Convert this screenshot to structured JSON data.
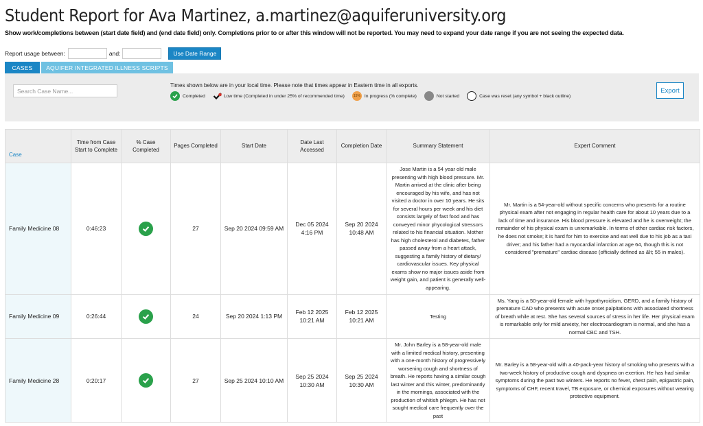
{
  "page": {
    "title": "Student Report for Ava Martinez, a.martinez@aquiferuniversity.org",
    "subtitle": "Show work/completions between (start date field) and (end date field) only. Completions prior to or after this window will not be reported. You may need to expand your date range if you are not seeing the expected data."
  },
  "range": {
    "label_between": "Report usage between:",
    "label_and": "and:",
    "start_value": "",
    "end_value": "",
    "button": "Use Date Range"
  },
  "tabs": [
    {
      "label": "CASES",
      "active": true
    },
    {
      "label": "AQUIFER INTEGRATED ILLNESS SCRIPTS",
      "active": false
    }
  ],
  "panel": {
    "search_placeholder": "Search Case Name...",
    "note": "Times shown below are in your local time. Please note that times appear in Eastern time in all exports.",
    "legend": {
      "completed": "Completed",
      "low_time": "Low time (Completed in under 25% of recommended time)",
      "in_progress_badge": "15%",
      "in_progress": "In progress (% complete)",
      "not_started": "Not started",
      "reset": "Case was reset (any symbol + black outline)"
    },
    "export": "Export"
  },
  "colors": {
    "accent": "#1b86c5",
    "tab_inactive": "#6fc1e2",
    "completed": "#2aa14b",
    "in_progress": "#f0a04a",
    "not_started": "#888888",
    "low_time_mark": "#d0342c"
  },
  "table": {
    "headers": {
      "case": "Case",
      "time": "Time from Case Start to Complete",
      "pct": "% Case Completed",
      "pages": "Pages Completed",
      "start": "Start Date",
      "last": "Date Last Accessed",
      "completion": "Completion Date",
      "summary": "Summary Statement",
      "expert": "Expert Comment"
    },
    "rows": [
      {
        "case": "Family Medicine 08",
        "time": "0:46:23",
        "status": "completed",
        "pages": "27",
        "start": "Sep 20 2024 09:59 AM",
        "last": "Dec 05 2024 4:16 PM",
        "completion": "Sep 20 2024 10:48 AM",
        "summary": "Jose Martin is a 54 year old male presenting with high blood pressure. Mr. Martin arrived at the clinic after being encouraged by his wife, and has not visited a doctor in over 10 years. He sits for several hours per week and his diet consists largely of fast food and has conveyed minor phycological stressors related to his financial situation. Mother has high cholesterol and diabetes, father passed away from a heart attack, suggesting a family history of dietary/ cardiovascular issues. Key physical exams show no major issues aside from weight gain, and patient is generally well-appearing.",
        "expert": "Mr. Martin is a 54-year-old without specific concerns who presents for a routine physical exam after not engaging in regular health care for about 10 years due to a lack of time and insurance. His blood pressure is elevated and he is overweight; the remainder of his physical exam is unremarkable. In terms of other cardiac risk factors, he does not smoke; it is hard for him to exercise and eat well due to his job as a taxi driver; and his father had a myocardial infarction at age 64, though this is not considered \"premature\" cardiac disease (officially defined as &lt; 55 in males)."
      },
      {
        "case": "Family Medicine 09",
        "time": "0:26:44",
        "status": "completed",
        "pages": "24",
        "start": "Sep 20 2024 1:13 PM",
        "last": "Feb 12 2025 10:21 AM",
        "completion": "Feb 12 2025 10:21 AM",
        "summary": "Testing",
        "expert": "Ms. Yang is a 50-year-old female with hypothyroidism, GERD, and a family history of premature CAD who presents with acute onset palpitations with associated shortness of breath while at rest. She has several sources of stress in her life. Her physical exam is remarkable only for mild anxiety, her electrocardiogram is normal, and she has a normal CBC and TSH."
      },
      {
        "case": "Family Medicine 28",
        "time": "0:20:17",
        "status": "completed",
        "pages": "27",
        "start": "Sep 25 2024 10:10 AM",
        "last": "Sep 25 2024 10:30 AM",
        "completion": "Sep 25 2024 10:30 AM",
        "summary": "Mr. John Barley is a 58-year-old male with a limited medical history, presenting with a one-month history of progressively worsening cough and shortness of breath. He reports having a similar cough last winter and this winter, predominantly in the mornings, associated with the production of whitish phlegm. He has not sought medical care frequently over the past",
        "expert": "Mr. Barley is a 58-year-old with a 40-pack-year history of smoking who presents with a two-week history of productive cough and dyspnea on exertion. He has had similar symptoms during the past two winters. He reports no fever, chest pain, epigastric pain, symptoms of CHF, recent travel, TB exposure, or chemical exposures without wearing protective equipment."
      }
    ]
  }
}
